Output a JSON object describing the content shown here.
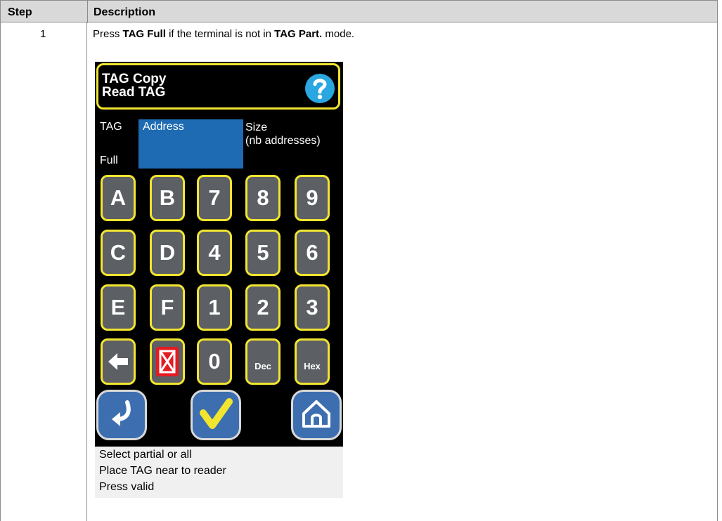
{
  "table": {
    "header": {
      "step": "Step",
      "description": "Description"
    },
    "row": {
      "step": "1",
      "instruction": {
        "part1": "Press ",
        "bold1": "TAG Full",
        "part2": " if the terminal is not in ",
        "bold2": "TAG Part.",
        "part3": " mode."
      }
    }
  },
  "device": {
    "title_line1": "TAG Copy",
    "title_line2": "Read TAG",
    "help_icon": "help-question-icon",
    "tag_label": "TAG",
    "full_label": "Full",
    "address_label": "Address",
    "size_line1": "Size",
    "size_line2": "(nb addresses)",
    "keys": {
      "row1": [
        "A",
        "B",
        "7",
        "8",
        "9"
      ],
      "row2": [
        "C",
        "D",
        "4",
        "5",
        "6"
      ],
      "row3": [
        "E",
        "F",
        "1",
        "2",
        "3"
      ],
      "row4": [
        "back-arrow-icon",
        "delete-x-icon",
        "0",
        "Dec",
        "Hex"
      ]
    },
    "bottom_buttons": [
      "return-arrow-icon",
      "validate-check-icon",
      "home-icon"
    ],
    "status_lines": [
      "Select partial or all",
      "Place TAG near to reader",
      "Press valid"
    ]
  },
  "colors": {
    "screen_bg": "#000000",
    "accent_yellow": "#f2e530",
    "key_gray": "#5c5f63",
    "address_blue": "#1e6bb3",
    "button_blue": "#3d6fb0",
    "delete_red": "#e31b23",
    "help_blue": "#2aa6e0"
  }
}
